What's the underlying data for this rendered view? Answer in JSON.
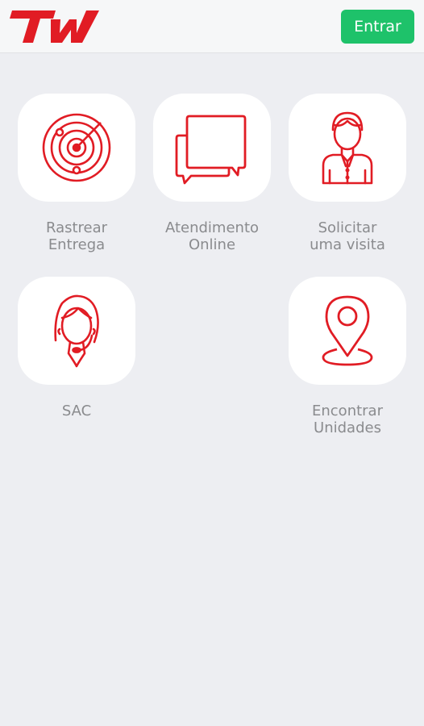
{
  "header": {
    "logo_text": "TW",
    "enter_label": "Entrar"
  },
  "colors": {
    "brand_red": "#e11c24",
    "enter_green": "#1ec26a",
    "background": "#edeef2",
    "label_gray": "#8a8b8e"
  },
  "tiles": [
    {
      "icon": "radar-icon",
      "line1": "Rastrear",
      "line2": "Entrega"
    },
    {
      "icon": "chat-bubbles-icon",
      "line1": "Atendimento",
      "line2": "Online"
    },
    {
      "icon": "person-icon",
      "line1": "Solicitar",
      "line2": "uma visita"
    },
    {
      "icon": "headset-agent-icon",
      "line1": "SAC",
      "line2": ""
    },
    {
      "icon": "map-pin-icon",
      "line1": "Encontrar",
      "line2": "Unidades"
    }
  ]
}
